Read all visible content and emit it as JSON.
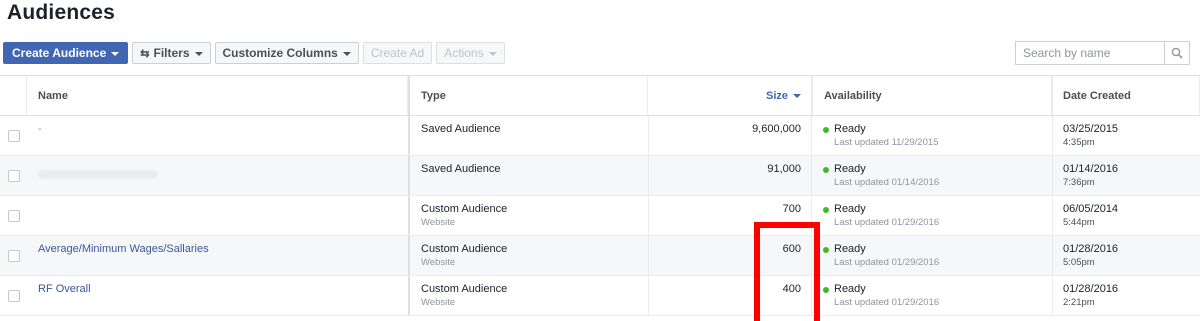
{
  "page": {
    "title": "Audiences"
  },
  "toolbar": {
    "create_audience": "Create Audience",
    "filters": "Filters",
    "customize_columns": "Customize Columns",
    "create_ad": "Create Ad",
    "actions": "Actions"
  },
  "search": {
    "placeholder": "Search by name",
    "value": ""
  },
  "table": {
    "headers": {
      "name": "Name",
      "type": "Type",
      "size": "Size",
      "availability": "Availability",
      "date_created": "Date Created"
    },
    "rows": [
      {
        "name": "-",
        "type": "Saved Audience",
        "type_sub": "",
        "size": "9,600,000",
        "status": "Ready",
        "last_updated": "Last updated 11/29/2015",
        "date": "03/25/2015",
        "time": "4:35pm"
      },
      {
        "name": "",
        "type": "Saved Audience",
        "type_sub": "",
        "size": "91,000",
        "status": "Ready",
        "last_updated": "Last updated 01/14/2016",
        "date": "01/14/2016",
        "time": "7:36pm"
      },
      {
        "name": "",
        "type": "Custom Audience",
        "type_sub": "Website",
        "size": "700",
        "status": "Ready",
        "last_updated": "Last updated 01/29/2016",
        "date": "06/05/2014",
        "time": "5:44pm"
      },
      {
        "name": "Average/Minimum Wages/Sallaries",
        "type": "Custom Audience",
        "type_sub": "Website",
        "size": "600",
        "status": "Ready",
        "last_updated": "Last updated 01/29/2016",
        "date": "01/28/2016",
        "time": "5:05pm"
      },
      {
        "name": "RF Overall",
        "type": "Custom Audience",
        "type_sub": "Website",
        "size": "400",
        "status": "Ready",
        "last_updated": "Last updated 01/29/2016",
        "date": "01/28/2016",
        "time": "2:21pm"
      }
    ]
  },
  "colors": {
    "primary_button": "#4267b2",
    "link": "#365899",
    "ready_dot": "#42b72a",
    "annotation": "#ff0000"
  },
  "icons": {
    "filters": "sliders-icon",
    "search": "magnifier-icon",
    "dropdown": "caret-down-icon",
    "sort": "sort-desc-icon"
  }
}
